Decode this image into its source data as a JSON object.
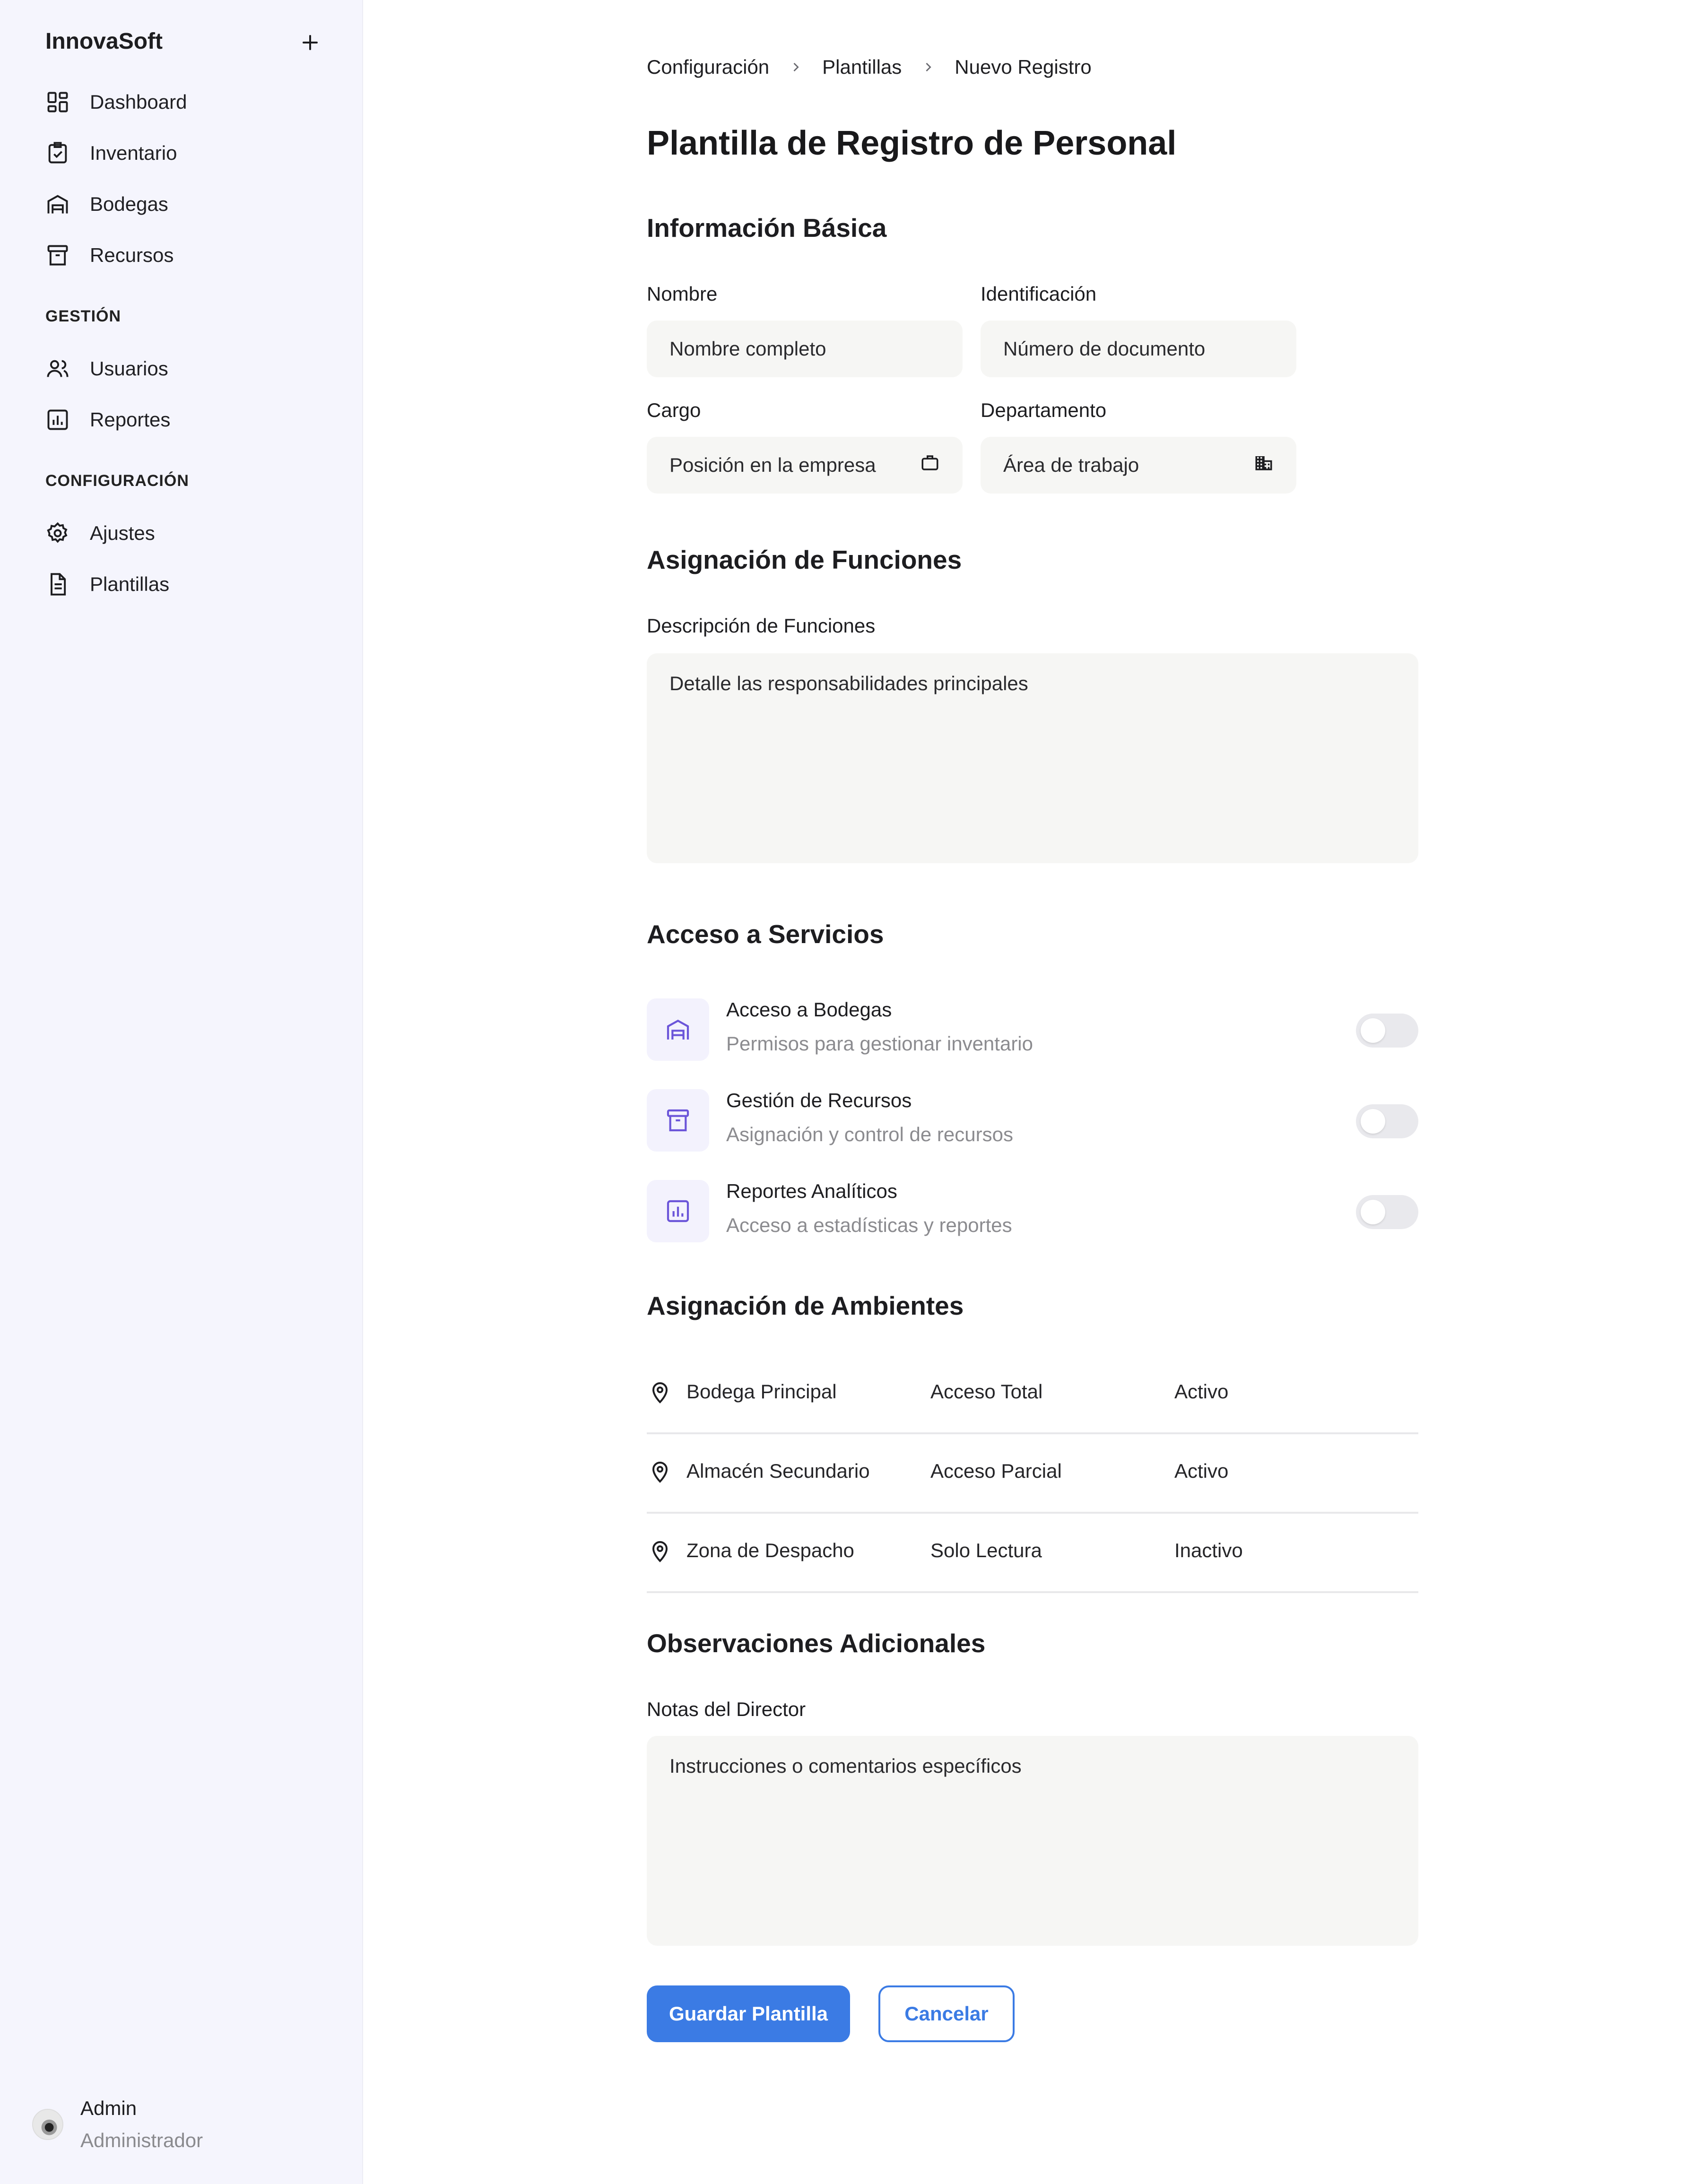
{
  "sidebar": {
    "brand": "InnovaSoft",
    "main_items": [
      {
        "label": "Dashboard",
        "icon": "dashboard-icon"
      },
      {
        "label": "Inventario",
        "icon": "clipboard-check-icon"
      },
      {
        "label": "Bodegas",
        "icon": "warehouse-icon"
      },
      {
        "label": "Recursos",
        "icon": "archive-box-icon"
      }
    ],
    "sections": [
      {
        "title": "GESTIÓN",
        "items": [
          {
            "label": "Usuarios",
            "icon": "users-icon"
          },
          {
            "label": "Reportes",
            "icon": "chart-icon"
          }
        ]
      },
      {
        "title": "CONFIGURACIÓN",
        "items": [
          {
            "label": "Ajustes",
            "icon": "gear-icon"
          },
          {
            "label": "Plantillas",
            "icon": "document-icon"
          }
        ]
      }
    ],
    "user": {
      "name": "Admin",
      "role": "Administrador"
    }
  },
  "breadcrumb": [
    "Configuración",
    "Plantillas",
    "Nuevo Registro"
  ],
  "page_title": "Plantilla de Registro de Personal",
  "basic_info": {
    "title": "Información Básica",
    "fields": [
      {
        "label": "Nombre",
        "placeholder": "Nombre completo"
      },
      {
        "label": "Identificación",
        "placeholder": "Número de documento"
      },
      {
        "label": "Cargo",
        "placeholder": "Posición en la empresa",
        "icon": "briefcase-icon"
      },
      {
        "label": "Departamento",
        "placeholder": "Área de trabajo",
        "icon": "building-icon"
      }
    ]
  },
  "functions": {
    "title": "Asignación de Funciones",
    "label": "Descripción de Funciones",
    "placeholder": "Detalle las responsabilidades principales"
  },
  "services": {
    "title": "Acceso a Servicios",
    "items": [
      {
        "title": "Acceso a Bodegas",
        "description": "Permisos para gestionar inventario",
        "icon": "warehouse-icon",
        "enabled": false
      },
      {
        "title": "Gestión de Recursos",
        "description": "Asignación y control de recursos",
        "icon": "archive-box-icon",
        "enabled": false
      },
      {
        "title": "Reportes Analíticos",
        "description": "Acceso a estadísticas y reportes",
        "icon": "chart-icon",
        "enabled": false
      }
    ]
  },
  "environments": {
    "title": "Asignación de Ambientes",
    "rows": [
      {
        "name": "Bodega Principal",
        "access": "Acceso Total",
        "status": "Activo"
      },
      {
        "name": "Almacén Secundario",
        "access": "Acceso Parcial",
        "status": "Activo"
      },
      {
        "name": "Zona de Despacho",
        "access": "Solo Lectura",
        "status": "Inactivo"
      }
    ]
  },
  "observations": {
    "title": "Observaciones Adicionales",
    "label": "Notas del Director",
    "placeholder": "Instrucciones o comentarios específicos"
  },
  "actions": {
    "save": "Guardar Plantilla",
    "cancel": "Cancelar"
  },
  "colors": {
    "accent": "#3b7be4",
    "icon_purple": "#6b55d9",
    "sidebar_bg": "#f5f5fd",
    "input_bg": "#f6f6f4"
  }
}
